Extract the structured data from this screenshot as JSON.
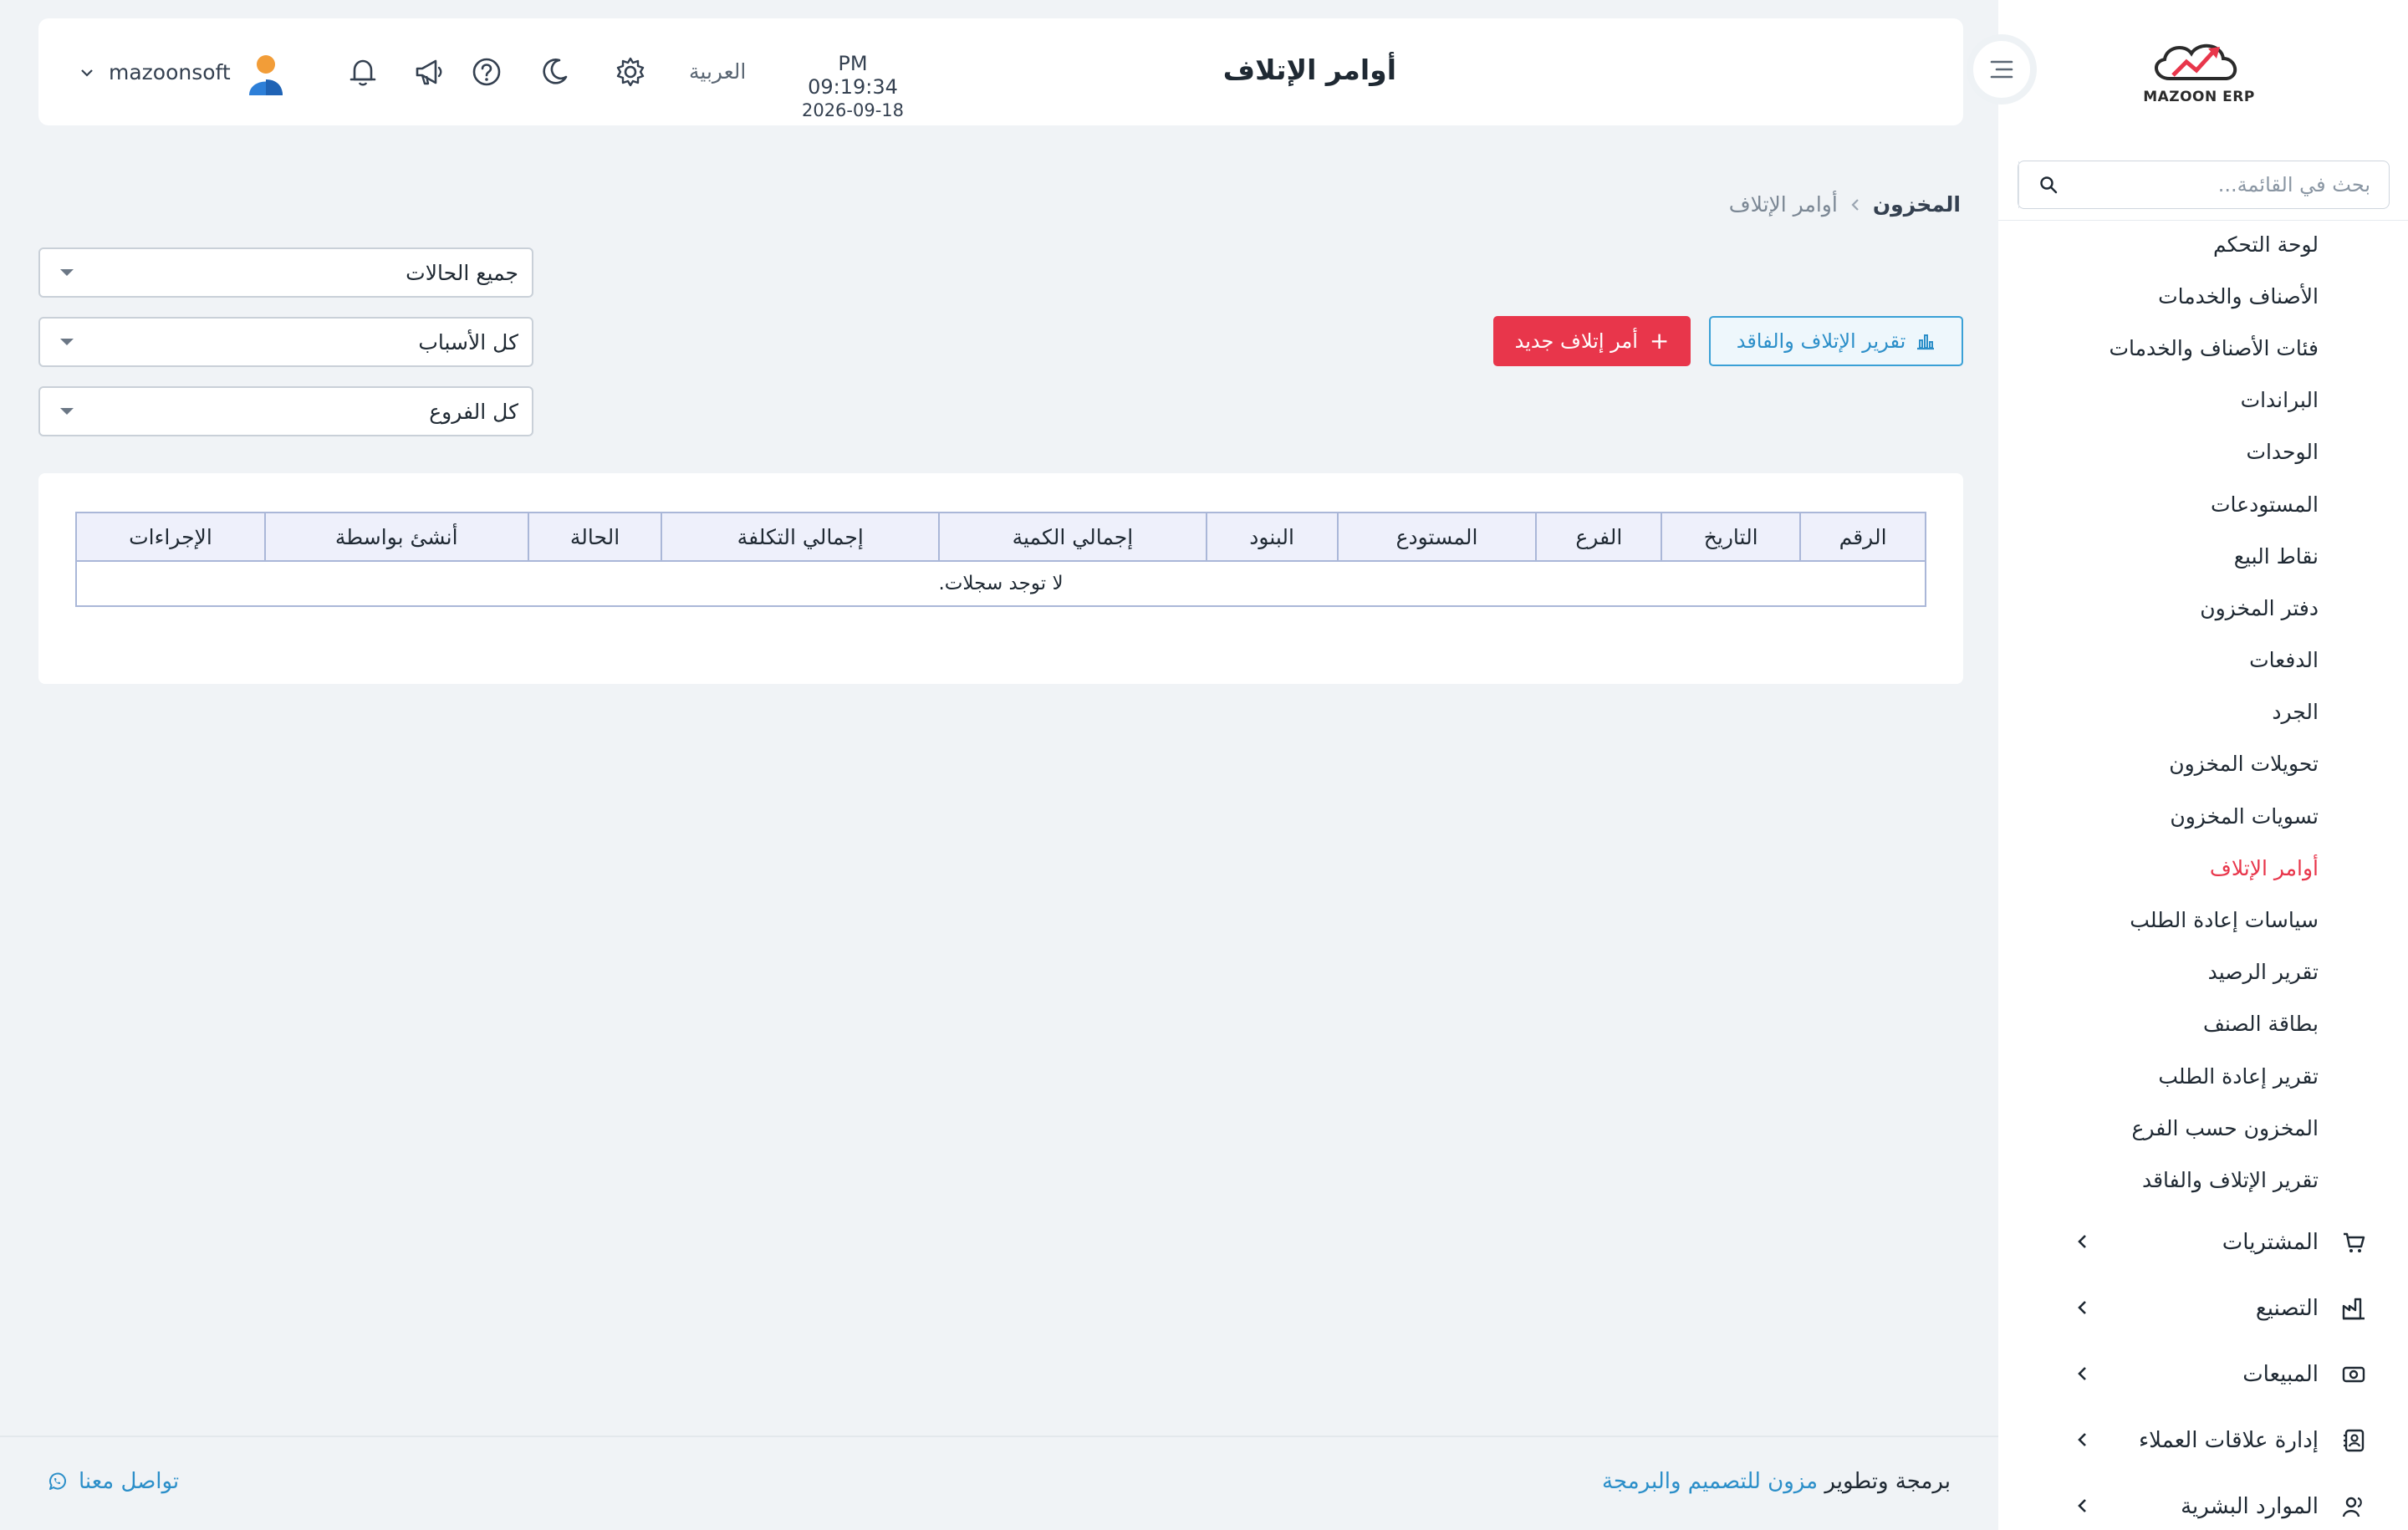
{
  "app": {
    "logo_text": "MAZOON ERP",
    "accent_color": "#e8364b",
    "link_color": "#2c8fc9"
  },
  "sidebar": {
    "search_placeholder": "بحث في القائمة...",
    "submenu": [
      {
        "label": "لوحة التحكم",
        "active": false
      },
      {
        "label": "الأصناف والخدمات",
        "active": false
      },
      {
        "label": "فئات الأصناف والخدمات",
        "active": false
      },
      {
        "label": "البراندات",
        "active": false
      },
      {
        "label": "الوحدات",
        "active": false
      },
      {
        "label": "المستودعات",
        "active": false
      },
      {
        "label": "نقاط البيع",
        "active": false
      },
      {
        "label": "دفتر المخزون",
        "active": false
      },
      {
        "label": "الدفعات",
        "active": false
      },
      {
        "label": "الجرد",
        "active": false
      },
      {
        "label": "تحويلات المخزون",
        "active": false
      },
      {
        "label": "تسويات المخزون",
        "active": false
      },
      {
        "label": "أوامر الإتلاف",
        "active": true
      },
      {
        "label": "سياسات إعادة الطلب",
        "active": false
      },
      {
        "label": "تقرير الرصيد",
        "active": false
      },
      {
        "label": "بطاقة الصنف",
        "active": false
      },
      {
        "label": "تقرير إعادة الطلب",
        "active": false
      },
      {
        "label": "المخزون حسب الفرع",
        "active": false
      },
      {
        "label": "تقرير الإتلاف والفاقد",
        "active": false
      }
    ],
    "groups": [
      {
        "label": "المشتريات",
        "icon": "cart-icon"
      },
      {
        "label": "التصنيع",
        "icon": "factory-icon"
      },
      {
        "label": "المبيعات",
        "icon": "cash-icon"
      },
      {
        "label": "إدارة علاقات العملاء",
        "icon": "contacts-icon"
      },
      {
        "label": "الموارد البشرية",
        "icon": "users-icon"
      }
    ]
  },
  "header": {
    "title": "أوامر الإتلاف",
    "time": "PM 09:19:34",
    "date": "2026-09-18",
    "language": "العربية",
    "username": "mazoonsoft"
  },
  "breadcrumb": {
    "root": "المخزون",
    "current": "أوامر الإتلاف"
  },
  "actions": {
    "report_label": "تقرير الإتلاف والفاقد",
    "new_label": "أمر إتلاف جديد",
    "new_plus": "+"
  },
  "filters": {
    "status": "جميع الحالات",
    "reason": "كل الأسباب",
    "branch": "كل الفروع"
  },
  "table": {
    "columns": [
      "الرقم",
      "التاريخ",
      "الفرع",
      "المستودع",
      "البنود",
      "إجمالي الكمية",
      "إجمالي التكلفة",
      "الحالة",
      "أنشئ بواسطة",
      "الإجراءات"
    ],
    "empty_message": "لا توجد سجلات."
  },
  "footer": {
    "credit_prefix": "برمجة وتطوير",
    "company": "مزون للتصميم والبرمجة",
    "contact": "تواصل معنا"
  }
}
